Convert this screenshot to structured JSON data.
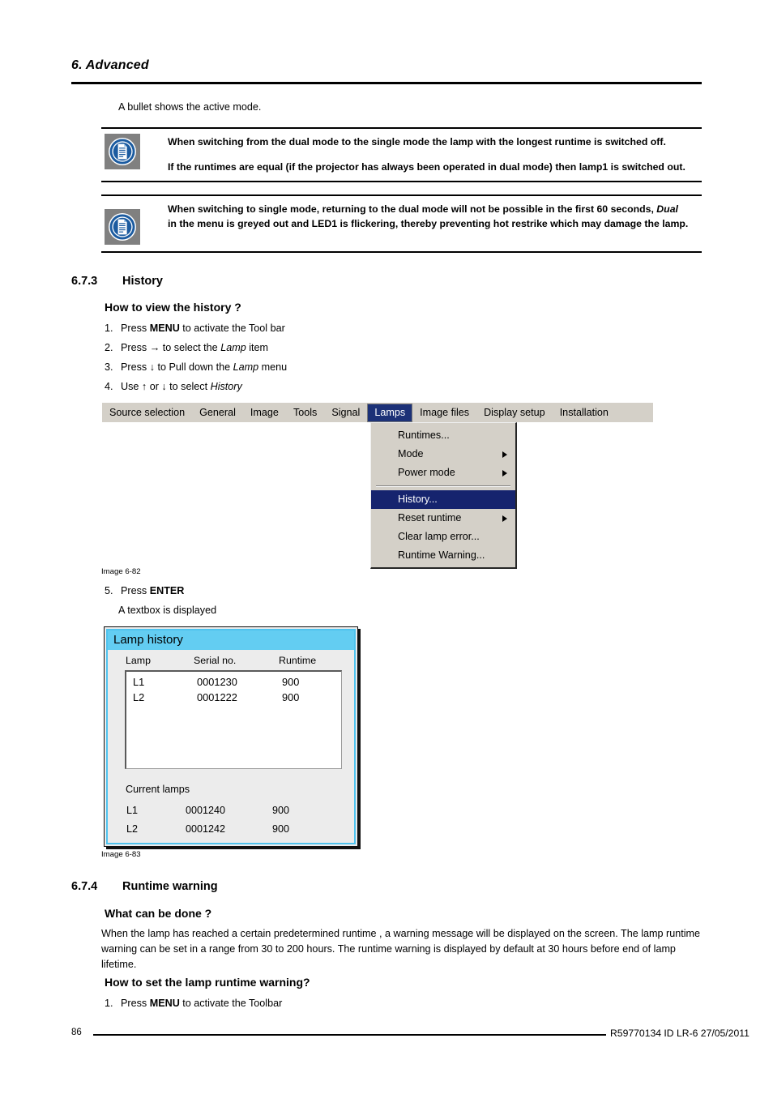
{
  "header": {
    "chapter": "6.  Advanced"
  },
  "intro_text": "A bullet shows the active mode.",
  "notes": [
    {
      "icon": "note-document-icon",
      "lines": [
        "When switching from the dual mode to the single mode the lamp with the longest runtime is switched off.",
        "If the runtimes are equal (if the projector has always been operated in dual mode) then lamp1 is switched out."
      ]
    },
    {
      "icon": "note-document-icon",
      "lines_rich": {
        "part1": "When switching to single mode, returning to the dual mode will not be possible in the first 60 seconds, ",
        "emphasis": "Dual",
        "part2": "in the menu is greyed out and LED1 is flickering, thereby preventing hot restrike which may damage the lamp."
      }
    }
  ],
  "section_history": {
    "number": "6.7.3",
    "title": "History",
    "subhead": "How to view the history ?",
    "steps": [
      {
        "n": "1.",
        "pre": "Press ",
        "bold": "MENU",
        "post": " to activate the Tool bar"
      },
      {
        "n": "2.",
        "pre": "Press → to select the ",
        "italic": "Lamp",
        "post": " item"
      },
      {
        "n": "3.",
        "pre": "Press ↓ to Pull down the ",
        "italic": "Lamp",
        "post": " menu"
      },
      {
        "n": "4.",
        "pre": "Use ↑ or ↓ to select ",
        "italic": "History",
        "post": ""
      }
    ],
    "step5": {
      "n": "5.",
      "pre": "Press ",
      "bold": "ENTER",
      "post": ""
    },
    "step5_sub": "A textbox is displayed"
  },
  "menu_screenshot": {
    "caption": "Image 6-82",
    "menubar": [
      {
        "label": "Source selection",
        "active": false
      },
      {
        "label": "General",
        "active": false
      },
      {
        "label": "Image",
        "active": false
      },
      {
        "label": "Tools",
        "active": false
      },
      {
        "label": "Signal",
        "active": false
      },
      {
        "label": "Lamps",
        "active": true
      },
      {
        "label": "Image files",
        "active": false
      },
      {
        "label": "Display setup",
        "active": false
      },
      {
        "label": "Installation",
        "active": false
      }
    ],
    "dropdown": [
      {
        "label": "Runtimes...",
        "submenu": false,
        "selected": false
      },
      {
        "label": "Mode",
        "submenu": true,
        "selected": false
      },
      {
        "label": "Power mode",
        "submenu": true,
        "selected": false
      },
      {
        "separator": true
      },
      {
        "label": "History...",
        "submenu": false,
        "selected": true
      },
      {
        "label": "Reset runtime",
        "submenu": true,
        "selected": false
      },
      {
        "label": "Clear lamp error...",
        "submenu": false,
        "selected": false
      },
      {
        "label": "Runtime Warning...",
        "submenu": false,
        "selected": false
      }
    ],
    "active_color": "#1c3177",
    "selected_color": "#16246e",
    "bar_color": "#d4d0c8"
  },
  "lamp_dialog": {
    "caption": "Image 6-83",
    "title": "Lamp history",
    "title_color": "#63cdf2",
    "columns": [
      "Lamp",
      "Serial no.",
      "Runtime"
    ],
    "history_rows": [
      {
        "lamp": "L1",
        "serial": "0001230",
        "runtime": "900"
      },
      {
        "lamp": "L2",
        "serial": "0001222",
        "runtime": "900"
      }
    ],
    "current_label": "Current lamps",
    "current_rows": [
      {
        "lamp": "L1",
        "serial": "0001240",
        "runtime": "900"
      },
      {
        "lamp": "L2",
        "serial": "0001242",
        "runtime": "900"
      }
    ]
  },
  "section_runtime_warning": {
    "number": "6.7.4",
    "title": "Runtime warning",
    "subhead1": "What can be done ?",
    "paragraph": "When the lamp has reached a certain predetermined runtime , a warning message will be displayed on the screen.  The lamp runtime warning can be set in a range from 30 to 200 hours.  The runtime warning is displayed by default at 30 hours before end of lamp lifetime.",
    "subhead2": "How to set the lamp runtime warning?",
    "step1": {
      "n": "1.",
      "pre": "Press ",
      "bold": "MENU",
      "post": " to activate the Toolbar"
    }
  },
  "footer": {
    "page_number": "86",
    "reference": "R59770134  ID LR-6  27/05/2011"
  }
}
